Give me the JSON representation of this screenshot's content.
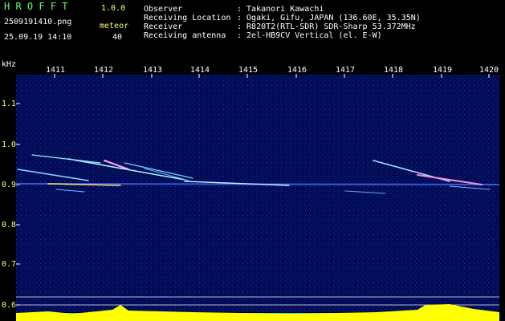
{
  "app": {
    "name": "H R O F F T",
    "version": "1.0.0"
  },
  "file": {
    "name": "2509191410.png",
    "datetime": "25.09.19 14:10"
  },
  "counter": {
    "label": "meteor",
    "value": "40"
  },
  "info": [
    {
      "key": "Observer",
      "value": ": Takanori Kawachi"
    },
    {
      "key": "Receiving Location",
      "value": ": Ogaki, Gifu, JAPAN (136.60E, 35.35N)"
    },
    {
      "key": "Receiver",
      "value": ": R820T2(RTL-SDR) SDR-Sharp 53.372MHz"
    },
    {
      "key": "Receiving antenna",
      "value": ": 2el-HB9CV Vertical (el. E-W)"
    }
  ],
  "axis": {
    "y_unit": "kHz",
    "y_ticks": [
      "1.1",
      "1.0",
      "0.9",
      "0.8",
      "0.7",
      "0.6"
    ],
    "x_ticks": [
      "1411",
      "1412",
      "1413",
      "1414",
      "1415",
      "1416",
      "1417",
      "1418",
      "1419",
      "1420"
    ]
  },
  "colors": {
    "header_green": "#66ff66",
    "label_yellow": "#ffff66",
    "spectrum_bg": "#000c5a",
    "level_yellow": "#ffff00",
    "level_cyan": "#00e5ff"
  }
}
